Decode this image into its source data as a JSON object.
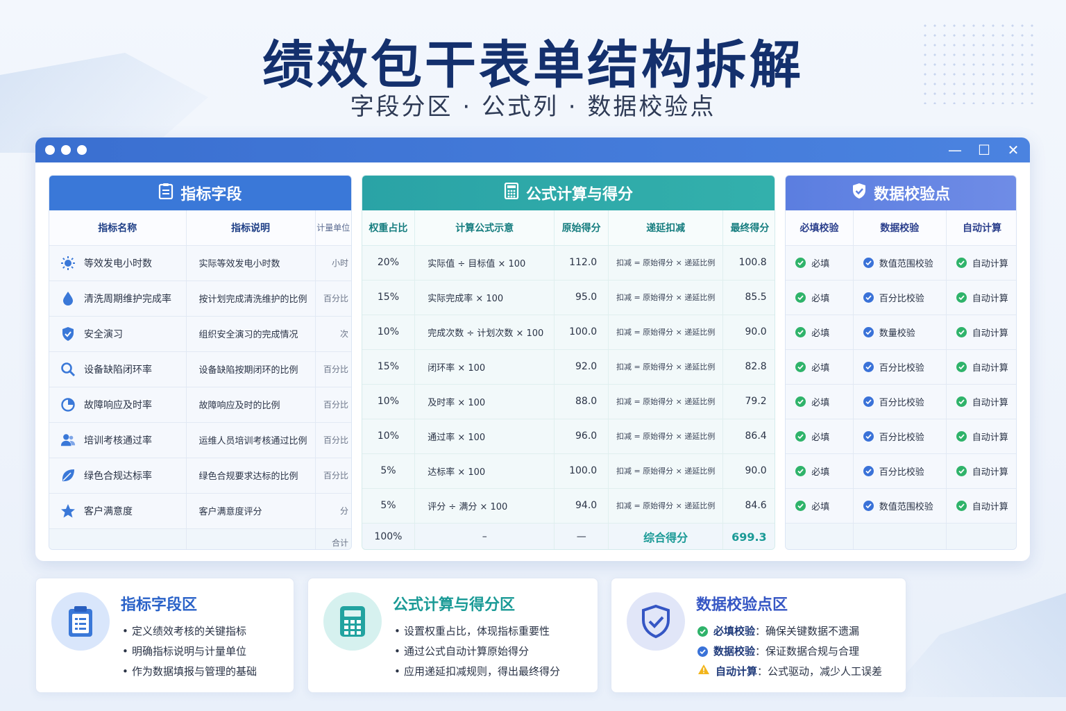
{
  "header": {
    "title": "绩效包干表单结构拆解",
    "subtitle": "字段分区 · 公式列 · 数据校验点"
  },
  "window": {
    "controls": {
      "minimize": "—",
      "maximize": "☐",
      "close": "✕"
    }
  },
  "panels": {
    "indicator": {
      "title": "指标字段",
      "columns": [
        "指标名称",
        "指标说明",
        "计量单位"
      ],
      "total_label": "合计"
    },
    "formula": {
      "title": "公式计算与得分",
      "columns": [
        "权重占比",
        "计算公式示意",
        "原始得分",
        "递延扣减",
        "最终得分"
      ],
      "total": {
        "weight": "100%",
        "formula": "–",
        "raw": "—",
        "label": "综合得分",
        "score": "699.3"
      }
    },
    "validation": {
      "title": "数据校验点",
      "columns": [
        "必填校验",
        "数据校验",
        "自动计算"
      ]
    }
  },
  "rows": [
    {
      "icon": "sun-icon",
      "name": "等效发电小时数",
      "desc": "实际等效发电小时数",
      "unit": "小时",
      "weight": "20%",
      "formula": "实际值 ÷ 目标值 × 100",
      "raw": "112.0",
      "deduct": "扣减 = 原始得分 × 递延比例",
      "final": "100.8",
      "required": "必填",
      "check": "数值范围校验",
      "auto": "自动计算"
    },
    {
      "icon": "water-drop-icon",
      "name": "清洗周期维护完成率",
      "desc": "按计划完成清洗维护的比例",
      "unit": "百分比",
      "weight": "15%",
      "formula": "实际完成率 × 100",
      "raw": "95.0",
      "deduct": "扣减 = 原始得分 × 递延比例",
      "final": "85.5",
      "required": "必填",
      "check": "百分比校验",
      "auto": "自动计算"
    },
    {
      "icon": "shield-check-icon",
      "name": "安全演习",
      "desc": "组织安全演习的完成情况",
      "unit": "次",
      "weight": "10%",
      "formula": "完成次数 ÷ 计划次数 × 100",
      "raw": "100.0",
      "deduct": "扣减 = 原始得分 × 递延比例",
      "final": "90.0",
      "required": "必填",
      "check": "数量校验",
      "auto": "自动计算"
    },
    {
      "icon": "search-icon",
      "name": "设备缺陷闭环率",
      "desc": "设备缺陷按期闭环的比例",
      "unit": "百分比",
      "weight": "15%",
      "formula": "闭环率 × 100",
      "raw": "92.0",
      "deduct": "扣减 = 原始得分 × 递延比例",
      "final": "82.8",
      "required": "必填",
      "check": "百分比校验",
      "auto": "自动计算"
    },
    {
      "icon": "pie-chart-icon",
      "name": "故障响应及时率",
      "desc": "故障响应及时的比例",
      "unit": "百分比",
      "weight": "10%",
      "formula": "及时率 × 100",
      "raw": "88.0",
      "deduct": "扣减 = 原始得分 × 递延比例",
      "final": "79.2",
      "required": "必填",
      "check": "百分比校验",
      "auto": "自动计算"
    },
    {
      "icon": "user-group-icon",
      "name": "培训考核通过率",
      "desc": "运维人员培训考核通过比例",
      "unit": "百分比",
      "weight": "10%",
      "formula": "通过率 × 100",
      "raw": "96.0",
      "deduct": "扣减 = 原始得分 × 递延比例",
      "final": "86.4",
      "required": "必填",
      "check": "百分比校验",
      "auto": "自动计算"
    },
    {
      "icon": "leaf-icon",
      "name": "绿色合规达标率",
      "desc": "绿色合规要求达标的比例",
      "unit": "百分比",
      "weight": "5%",
      "formula": "达标率 × 100",
      "raw": "100.0",
      "deduct": "扣减 = 原始得分 × 递延比例",
      "final": "90.0",
      "required": "必填",
      "check": "百分比校验",
      "auto": "自动计算"
    },
    {
      "icon": "star-icon",
      "name": "客户满意度",
      "desc": "客户满意度评分",
      "unit": "分",
      "weight": "5%",
      "formula": "评分 ÷ 满分 × 100",
      "raw": "94.0",
      "deduct": "扣减 = 原始得分 × 递延比例",
      "final": "84.6",
      "required": "必填",
      "check": "数值范围校验",
      "auto": "自动计算"
    }
  ],
  "cards": [
    {
      "title": "指标字段区",
      "items": [
        "定义绩效考核的关键指标",
        "明确指标说明与计量单位",
        "作为数据填报与管理的基础"
      ]
    },
    {
      "title": "公式计算与得分区",
      "items": [
        "设置权重占比，体现指标重要性",
        "通过公式自动计算原始得分",
        "应用递延扣减规则，得出最终得分"
      ]
    },
    {
      "title": "数据校验点区",
      "items": [
        {
          "label": "必填校验",
          "text": "：确保关键数据不遗漏"
        },
        {
          "label": "数据校验",
          "text": "：保证数据合规与合理"
        },
        {
          "label": "自动计算",
          "text": "：公式驱动，减少人工误差"
        }
      ]
    }
  ],
  "colors": {
    "title": "#14306d",
    "indicator_head": "#3a78d8",
    "formula_head": "#2aa3a6",
    "validation_head": "#5b7ee0",
    "check_green": "#2fb36a",
    "check_blue": "#3a72d8",
    "warning": "#f2b51c"
  }
}
